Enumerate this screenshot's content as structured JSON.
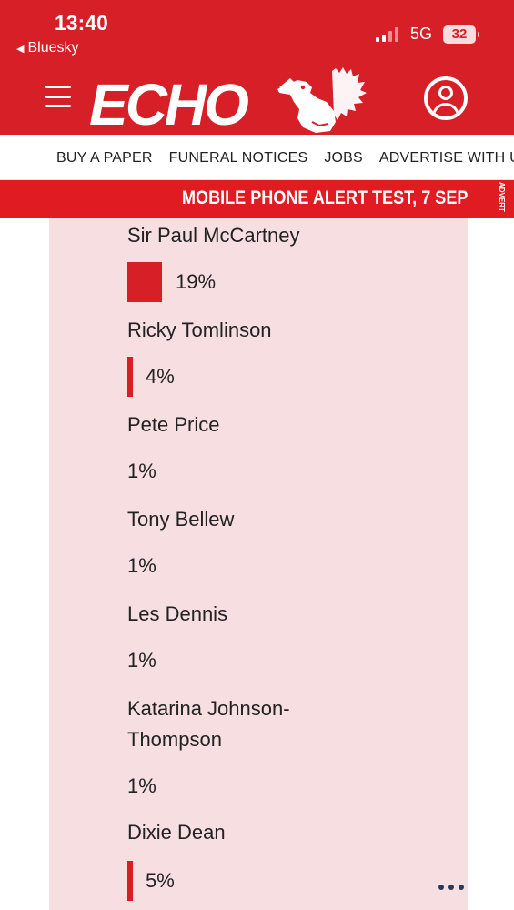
{
  "status_bar": {
    "time": "13:40",
    "back_app": "Bluesky",
    "network": "5G",
    "battery": "32"
  },
  "header": {
    "logo_text": "ECHO",
    "brand_color": "#d61f26"
  },
  "nav": {
    "items": [
      "BUY A PAPER",
      "FUNERAL NOTICES",
      "JOBS",
      "ADVERTISE WITH US"
    ]
  },
  "ticker": {
    "text": "MOBILE PHONE ALERT TEST, 7 SEP",
    "advert_label": "ADVERT"
  },
  "poll": {
    "options": [
      {
        "name": "Sir Paul McCartney",
        "percent_label": "19%",
        "percent": 19
      },
      {
        "name": "Ricky Tomlinson",
        "percent_label": "4%",
        "percent": 4
      },
      {
        "name": "Pete Price",
        "percent_label": "1%",
        "percent": 1
      },
      {
        "name": "Tony Bellew",
        "percent_label": "1%",
        "percent": 1
      },
      {
        "name": "Les Dennis",
        "percent_label": "1%",
        "percent": 1
      },
      {
        "name": "Katarina Johnson-Thompson",
        "percent_label": "1%",
        "percent": 1
      },
      {
        "name": "Dixie Dean",
        "percent_label": "5%",
        "percent": 5
      }
    ]
  },
  "icons": {
    "menu": "hamburger-menu-icon",
    "account": "user-account-icon",
    "more": "more-options-icon",
    "back": "back-arrow-icon"
  }
}
